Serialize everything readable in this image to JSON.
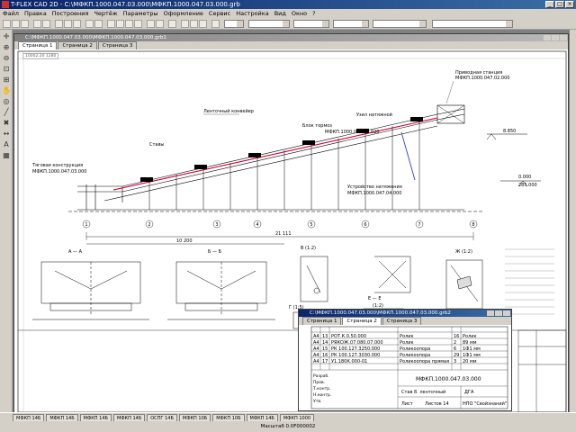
{
  "window": {
    "title": "T-FLEX CAD 2D - C:\\МФКП.1000.047.03.000\\МФКП.1000.047.03.000.grb"
  },
  "menu": [
    "Файл",
    "Правка",
    "Построения",
    "Чертёж",
    "Параметры",
    "Оформление",
    "Сервис",
    "Настройка",
    "Вид",
    "Окно",
    "?"
  ],
  "document1": {
    "title": "C:\\МФКП.1000.047.03.000\\МФКП.1000.047.03.000.grb1",
    "tabs": [
      "Страница 1",
      "Страница 2",
      "Страница 3"
    ],
    "active_tab": 0
  },
  "drawing": {
    "annotations": {
      "conveyor": "Ленточный конвейер",
      "leg_left": "Тяговая конструкция",
      "part_left": "МФКП.1000.047.03.000",
      "ctrl_top": "Ставы",
      "ctrl_mid": "Блок тормоз",
      "ctrl_right": "Узел натяжной",
      "part_mid": "МФКП.1000.047.03.020",
      "drive": "Устройство натяжения",
      "drive_part": "МФКП.1000.047.04.000",
      "station": "Приводная станция",
      "station_part": "МФКП.1000.047.02.000",
      "elev_top": "8.850",
      "elev_zero": "0.000",
      "elev_dim": "285.000",
      "total_dim": "21 111",
      "left_dim": "10 200",
      "view_a": "А — А",
      "view_b": "Б — Б",
      "view_v": "В (1:2)",
      "view_g": "Г (1:5)",
      "view_e": "Е — Е",
      "view_e_scale": "(1:2)",
      "view_zh": "Ж (1:2)",
      "axis_labels": [
        "1",
        "2",
        "3",
        "4",
        "5",
        "6",
        "7",
        "8"
      ]
    },
    "coords": "10002.20 1280"
  },
  "document2": {
    "title": "C:\\МФКП.1000.047.03.000\\МФКП.1000.047.03.000.grb2",
    "tabs": [
      "Страница 1",
      "Страница 2",
      "Страница 3"
    ],
    "active_tab": 1,
    "spec_rows": [
      [
        "А4",
        "13",
        "РОТ.К.0.50.000",
        "Ролик",
        "16",
        "Ролик"
      ],
      [
        "А4",
        "14",
        "РЯКОЖ.07.080.07.000",
        "Ролик",
        "2",
        "89 мм"
      ],
      [
        "А4",
        "15",
        "РК 100.127.3250.000",
        "Роликоопора",
        "6",
        "1Ф1 мм"
      ],
      [
        "А4",
        "16",
        "РК 100.127.3030.000",
        "Роликоопора",
        "29",
        "1Ф1 мм"
      ],
      [
        "А4",
        "17",
        "У1.180К.000-01",
        "Роликоопора прямая",
        "3",
        "20 мм"
      ]
    ],
    "stamp_code": "МФКП.1000.047.03.000",
    "stamp_name": "Став 8. ленточный",
    "stamp_org": "НПО \"Свойзнаний\"",
    "stamp_sheet": "Лист",
    "stamp_sheets": "Листов 14",
    "stamp_lit": "ДГА",
    "sign_rows": [
      "Разраб.",
      "Пров.",
      "Т.контр.",
      "Н.контр.",
      "Утв."
    ]
  },
  "taskbar": [
    "МФКП 14Б",
    "МФКП 14Б",
    "МФКП 14Б",
    "МФКП 14Б",
    "ОСПГ 14Б",
    "МФКП 10Б",
    "МФКП 10Б",
    "МФКП 14Б",
    "МФКП 1000"
  ],
  "status": {
    "text": "Масштаб 0.0F000002"
  },
  "colors": {
    "title_bar": "#0a246a",
    "window_bg": "#d4d0c8",
    "highlight_red": "#c8003c",
    "highlight_blue": "#3040c0"
  },
  "icons": [
    "app-icon",
    "minimize-icon",
    "maximize-icon",
    "close-icon"
  ]
}
